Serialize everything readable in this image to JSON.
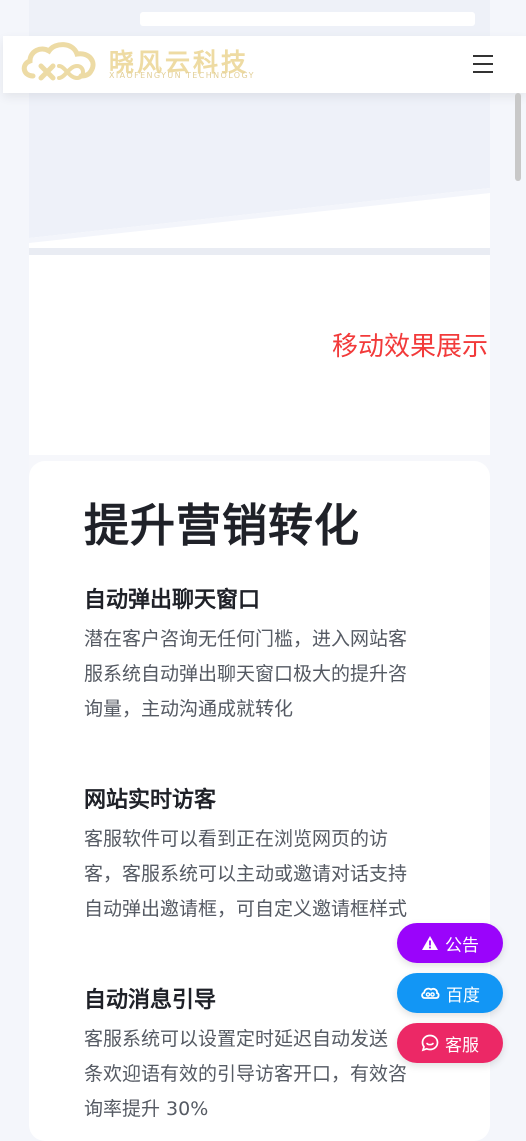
{
  "header": {
    "logo_cn": "晓风云科技",
    "logo_en": "XIAOFENGYUN TECHNOLOGY"
  },
  "mobile_section": {
    "title": "移动效果展示"
  },
  "marketing": {
    "title": "提升营销转化",
    "features": [
      {
        "title": "自动弹出聊天窗口",
        "lines": [
          "潜在客户咨询无任何门槛，进入网站客",
          "服系统自动弹出聊天窗口极大的提升咨",
          "询量，主动沟通成就转化"
        ]
      },
      {
        "title": "网站实时访客",
        "lines": [
          "客服软件可以看到正在浏览网页的访",
          "客，客服系统可以主动或邀请对话支持",
          "自动弹出邀请框，可自定义邀请框样式"
        ]
      },
      {
        "title": "自动消息引导",
        "lines": [
          "客服系统可以设置定时延迟自动发送",
          "条欢迎语有效的引导访客开口，有效咨",
          "询率提升 30%"
        ]
      }
    ]
  },
  "floating": {
    "notice_label": "公告",
    "baidu_label": "百度",
    "service_label": "客服",
    "notice_color": "#9a04fb",
    "baidu_color": "#1296f5",
    "service_color": "#ec2866"
  },
  "colors": {
    "accent_red": "#f23a3a",
    "logo_gold": "#eedba3"
  },
  "icons": {
    "menu": "hamburger-icon",
    "notice": "warning-icon",
    "baidu": "cloud-icon",
    "service": "chat-icon"
  }
}
